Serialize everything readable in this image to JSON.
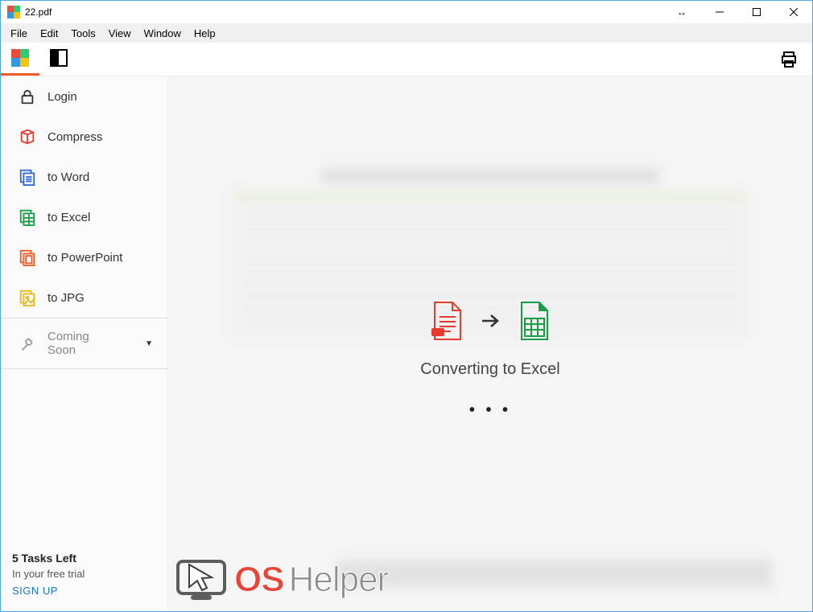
{
  "title": "22.pdf",
  "menubar": [
    "File",
    "Edit",
    "Tools",
    "View",
    "Window",
    "Help"
  ],
  "sidebar": {
    "items": [
      {
        "label": "Login"
      },
      {
        "label": "Compress"
      },
      {
        "label": "to Word"
      },
      {
        "label": "to Excel"
      },
      {
        "label": "to PowerPoint"
      },
      {
        "label": "to JPG"
      }
    ],
    "coming_soon": "Coming Soon",
    "tasks_left": "5 Tasks Left",
    "trial": "In your free trial",
    "signup": "SIGN UP"
  },
  "main": {
    "status": "Converting to Excel",
    "dots": "• • •"
  },
  "watermark": {
    "part1": "OS",
    "part2": "Helper"
  }
}
